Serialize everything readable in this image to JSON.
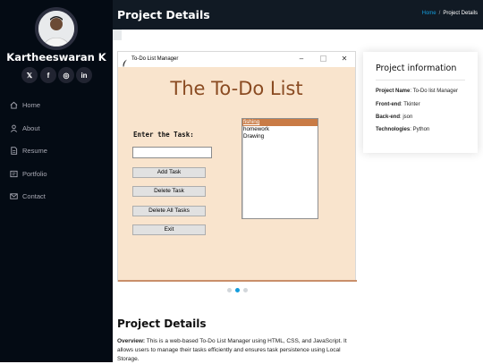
{
  "profile": {
    "name": "Kartheeswaran K",
    "socials": [
      {
        "icon": "x-twitter-icon",
        "glyph": "𝕏"
      },
      {
        "icon": "facebook-icon",
        "glyph": "f"
      },
      {
        "icon": "instagram-icon",
        "glyph": "◎"
      },
      {
        "icon": "linkedin-icon",
        "glyph": "in"
      }
    ]
  },
  "nav": [
    {
      "label": "Home",
      "icon": "home-icon"
    },
    {
      "label": "About",
      "icon": "person-icon"
    },
    {
      "label": "Resume",
      "icon": "file-icon"
    },
    {
      "label": "Portfolio",
      "icon": "book-icon"
    },
    {
      "label": "Contact",
      "icon": "envelope-icon"
    }
  ],
  "header": {
    "title": "Project Details",
    "breadcrumb": {
      "home": "Home",
      "separator": "/",
      "current": "Project Details"
    }
  },
  "tk_window": {
    "title": "To-Do List Manager",
    "heading": "The To-Do List",
    "task_label": "Enter the Task:",
    "entry_value": "",
    "buttons": [
      "Add Task",
      "Delete Task",
      "Delete All Tasks",
      "Exit"
    ],
    "tasks": [
      "fishing",
      "homework",
      "Drawing"
    ],
    "selected_task": "fishing"
  },
  "carousel": {
    "count": 3,
    "active_index": 1
  },
  "project_info": {
    "title": "Project information",
    "rows": [
      {
        "label": "Project Name",
        "value": ": To-Do list Manager"
      },
      {
        "label": "Front-end",
        "value": ": Tkinter"
      },
      {
        "label": "Back-end",
        "value": ": json"
      },
      {
        "label": "Technologies",
        "value": ": Python"
      }
    ]
  },
  "details": {
    "title": "Project Details",
    "overview_label": "Overview:",
    "overview_text": " This is a web-based To-Do List Manager using HTML, CSS, and JavaScript. It allows users to manage their tasks efficiently and ensures task persistence using Local Storage."
  },
  "colors": {
    "sidebar_bg": "#040b14",
    "header_bg": "#111a24",
    "accent": "#149ddd",
    "tk_bg": "#f9e4cd",
    "tk_heading": "#8a4b22",
    "tk_selection": "#c97b45"
  }
}
